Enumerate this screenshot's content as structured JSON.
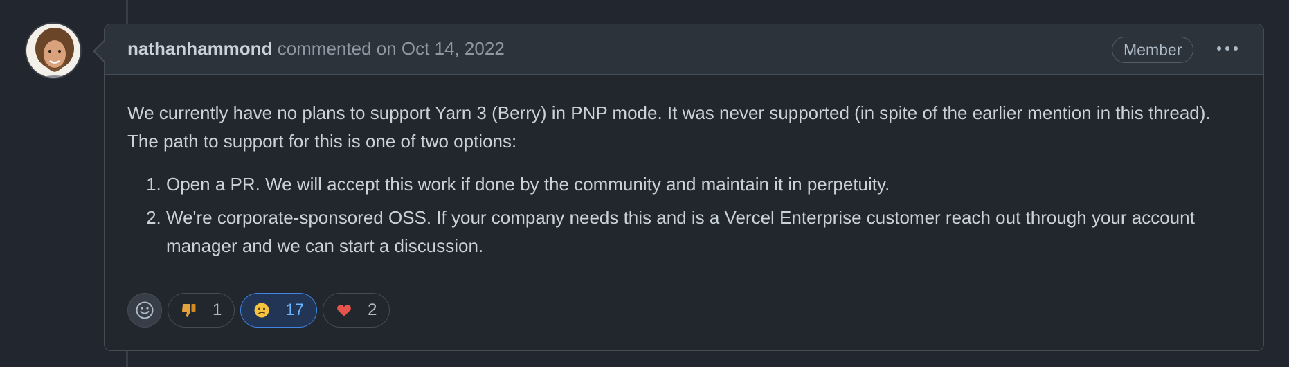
{
  "comment": {
    "author": "nathanhammond",
    "meta": "commented on Oct 14, 2022",
    "role_badge": "Member",
    "body": {
      "paragraph": "We currently have no plans to support Yarn 3 (Berry) in PNP mode. It was never supported (in spite of the earlier mention in this thread). The path to support for this is one of two options:",
      "list_items": [
        "Open a PR. We will accept this work if done by the community and maintain it in perpetuity.",
        "We're corporate-sponsored OSS. If your company needs this and is a Vercel Enterprise customer reach out through your account manager and we can start a discussion."
      ]
    },
    "reactions": [
      {
        "emoji": "👎",
        "icon": "thumbs-down-icon",
        "count": "1",
        "active": false
      },
      {
        "emoji": "😕",
        "icon": "confused-face-icon",
        "count": "17",
        "active": true
      },
      {
        "emoji": "❤",
        "icon": "heart-icon",
        "count": "2",
        "active": false
      }
    ]
  },
  "colors": {
    "background": "#22272e",
    "header_background": "#2d333b",
    "border": "#444c56",
    "accent_active": "#4184e4",
    "heart": "#e5534b",
    "thumbs": "#e6a23c"
  }
}
